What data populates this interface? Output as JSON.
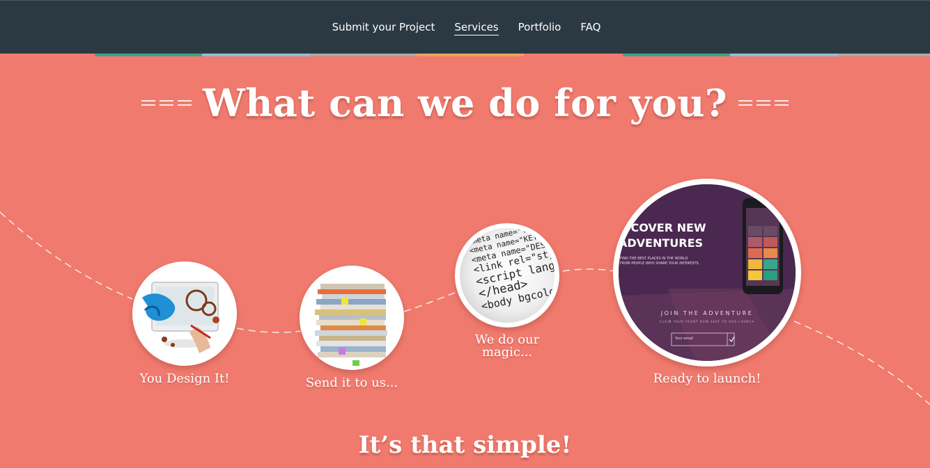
{
  "nav": {
    "items": [
      {
        "label": "Submit your Project",
        "active": false
      },
      {
        "label": "Services",
        "active": true
      },
      {
        "label": "Portfolio",
        "active": false
      },
      {
        "label": "FAQ",
        "active": false
      }
    ]
  },
  "colors": {
    "background": "#f07a6e",
    "navbar": "#2b3a42",
    "strip": [
      "#3aa58b",
      "#8fbfd8",
      "#a9a9a9",
      "#e8a25a",
      "#f07a6e",
      "#3aa58b",
      "#8fbfd8",
      "#a9a9a9"
    ]
  },
  "headline": "What can we do for you?",
  "steps": [
    {
      "label": "You Design It!",
      "icon": "design-artwork-image"
    },
    {
      "label": "Send it to us...",
      "icon": "paper-stack-image"
    },
    {
      "label": "We do our magic...",
      "icon": "code-html-image"
    },
    {
      "label": "Ready to launch!",
      "icon": "launch-website-image"
    }
  ],
  "launch_mock": {
    "title_line1": "ISCOVER NEW",
    "title_line2": "ADVENTURES",
    "subtitle_line1": "FIND THE BEST PLACES IN THE WORLD",
    "subtitle_line2": "FROM PEOPLE WHO SHARE YOUR INTERESTS.",
    "join": "JOIN THE ADVENTURE",
    "claim": "CLAIM YOUR FRONT ROW SEAT TO OUR LAUNCH",
    "email_placeholder": "Your email"
  },
  "code_lines": [
    "<meta name=\"TITLE",
    "<meta name=\"KEYWO",
    "<meta name=\"DESCR",
    "<link rel=\"style",
    "<script languag",
    "</head>",
    "<body bgcolo"
  ],
  "footer_line": "It’s that simple!"
}
